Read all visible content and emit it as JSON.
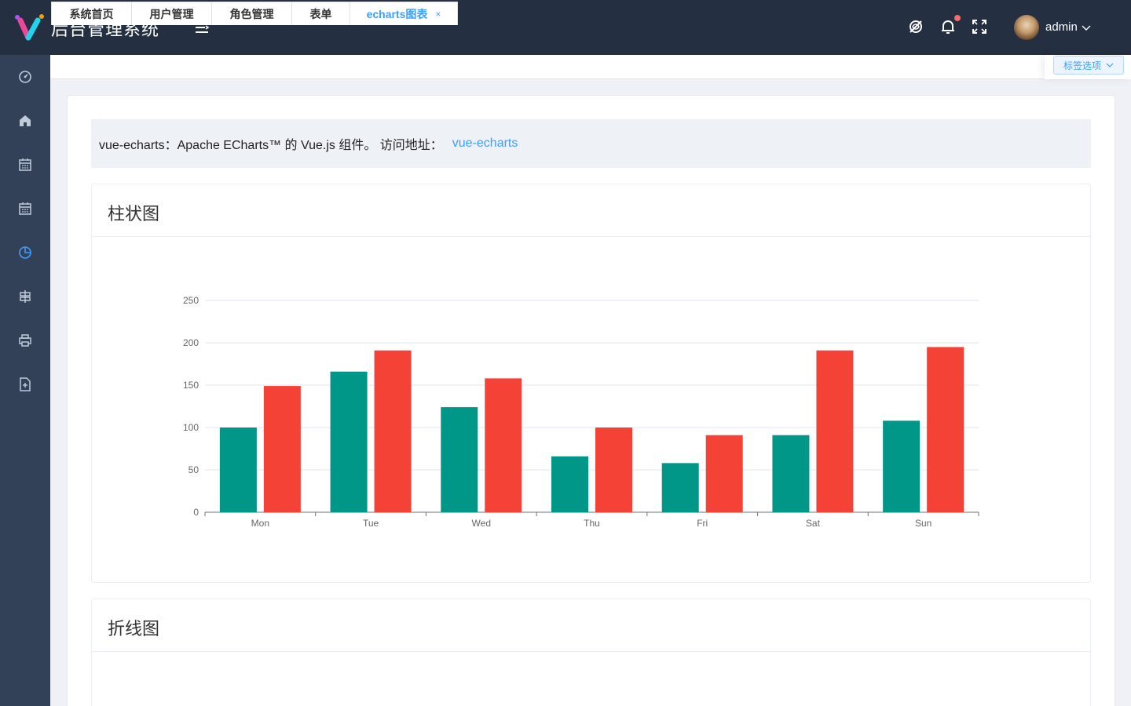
{
  "header": {
    "title": "后台管理系统",
    "user": "admin"
  },
  "tags": [
    {
      "label": "系统首页"
    },
    {
      "label": "用户管理"
    },
    {
      "label": "角色管理"
    },
    {
      "label": "表单"
    },
    {
      "label": "echarts图表",
      "close": "×"
    }
  ],
  "tags_options_label": "标签选项",
  "intro": {
    "text": "vue-echarts：Apache ECharts™ 的 Vue.js 组件。 访问地址：",
    "link": "vue-echarts"
  },
  "cards": {
    "bar_title": "柱状图",
    "line_title": "折线图"
  },
  "colors": {
    "header_bg": "#242f42",
    "sidebar_bg": "#324157",
    "accent": "#409eff",
    "series_1": "#009688",
    "series_2": "#f44336"
  },
  "chart_data": {
    "type": "bar",
    "categories": [
      "Mon",
      "Tue",
      "Wed",
      "Thu",
      "Fri",
      "Sat",
      "Sun"
    ],
    "series": [
      {
        "values": [
          100,
          166,
          124,
          66,
          58,
          91,
          108
        ],
        "color": "#009688"
      },
      {
        "values": [
          149,
          191,
          158,
          100,
          91,
          191,
          195
        ],
        "color": "#f44336"
      }
    ],
    "ylim": [
      0,
      250
    ],
    "yticks": [
      0,
      50,
      100,
      150,
      200,
      250
    ],
    "grid": true
  }
}
